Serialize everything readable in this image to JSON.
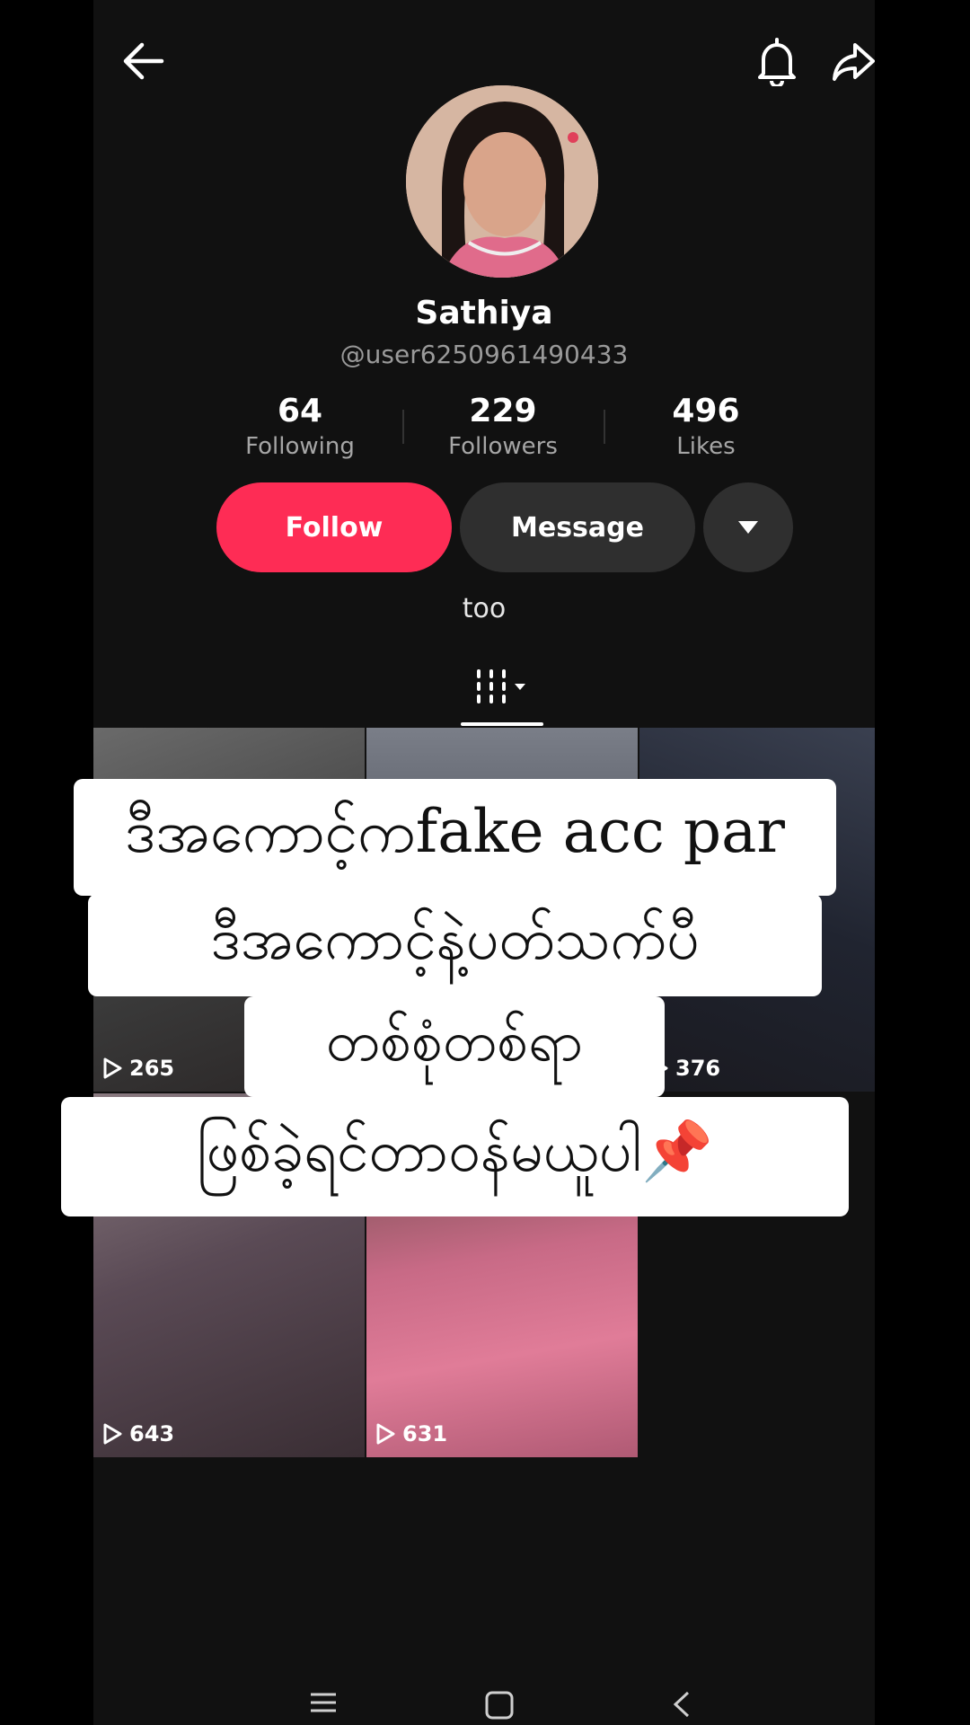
{
  "profile": {
    "display_name": "Sathiya",
    "username": "@user6250961490433",
    "bio": "too"
  },
  "stats": [
    {
      "value": "64",
      "label": "Following"
    },
    {
      "value": "229",
      "label": "Followers"
    },
    {
      "value": "496",
      "label": "Likes"
    }
  ],
  "actions": {
    "follow_label": "Follow",
    "message_label": "Message"
  },
  "videos": [
    {
      "views": "265"
    },
    {
      "views": "376"
    },
    {
      "views": "643"
    },
    {
      "views": "631"
    }
  ],
  "caption": {
    "line1": "ဒီအကောင့်ကfake  acc par",
    "line2": "ဒီအကောင့်နဲ့ပတ်သက်ပီ",
    "line3": "တစ်စုံတစ်ရာ",
    "line4": "ဖြစ်ခဲ့ရင်တာဝန်မယူပါ📌"
  },
  "colors": {
    "background": "#111111",
    "accent": "#fe2c55",
    "secondary_button": "#2f2f2f",
    "text_primary": "#ffffff",
    "text_secondary": "#9a9a9a"
  },
  "icons": [
    "back-arrow-icon",
    "bell-icon",
    "share-icon",
    "dropdown-triangle-icon",
    "grid-tab-icon",
    "play-icon",
    "menu-icon",
    "home-square-icon",
    "back-chevron-icon"
  ]
}
